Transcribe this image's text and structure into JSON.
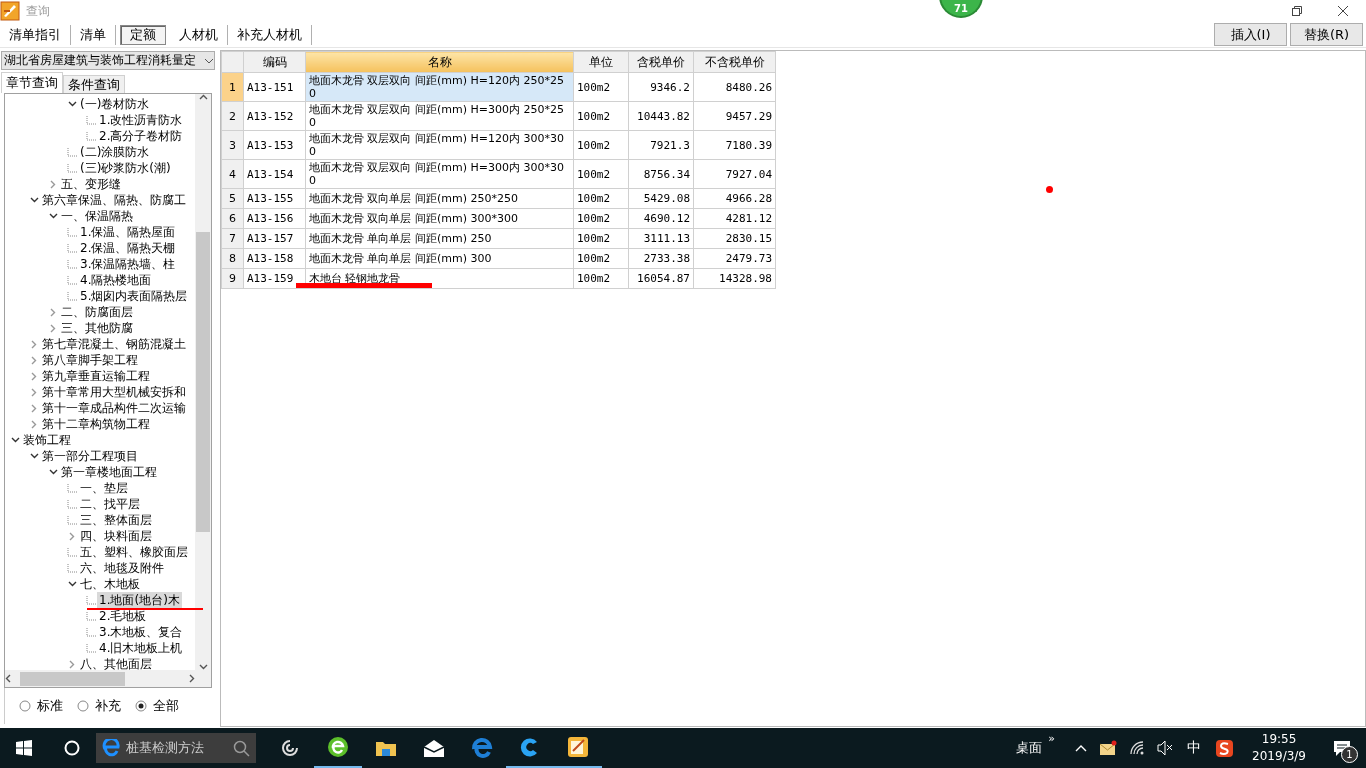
{
  "window": {
    "title": "查询",
    "badge": "71"
  },
  "tabs": [
    {
      "label": "清单指引",
      "selected": false
    },
    {
      "label": "清单",
      "selected": false
    },
    {
      "label": "定额",
      "selected": true
    },
    {
      "label": "人材机",
      "selected": false
    },
    {
      "label": "补充人材机",
      "selected": false
    }
  ],
  "buttons": [
    "插入(I)",
    "替换(R)"
  ],
  "library": {
    "value": "湖北省房屋建筑与装饰工程消耗量定"
  },
  "search_tabs": [
    {
      "label": "章节查询",
      "selected": true
    },
    {
      "label": "条件查询",
      "selected": false
    }
  ],
  "tree": [
    {
      "children": [
        {
          "children": [
            {
              "children": [
                {
                  "label": "(一)卷材防水",
                  "expanded": true,
                  "selected": false,
                  "children": [
                    {
                      "label": "1.改性沥青防水",
                      "selected": false
                    },
                    {
                      "label": "2.高分子卷材防",
                      "selected": false
                    }
                  ]
                },
                {
                  "label": "(二)涂膜防水",
                  "selected": false
                },
                {
                  "label": "(三)砂浆防水(潮)",
                  "selected": false
                }
              ]
            },
            {
              "label": "五、变形缝",
              "expanded": false,
              "selected": false
            }
          ]
        },
        {
          "label": "第六章保温、隔热、防腐工",
          "expanded": true,
          "selected": false,
          "children": [
            {
              "label": "一、保温隔热",
              "expanded": true,
              "selected": false,
              "children": [
                {
                  "label": "1.保温、隔热屋面",
                  "selected": false
                },
                {
                  "label": "2.保温、隔热天棚",
                  "selected": false
                },
                {
                  "label": "3.保温隔热墙、柱",
                  "selected": false
                },
                {
                  "label": "4.隔热楼地面",
                  "selected": false
                },
                {
                  "label": "5.烟囱内表面隔热层",
                  "selected": false
                }
              ]
            },
            {
              "label": "二、防腐面层",
              "expanded": false,
              "selected": false
            },
            {
              "label": "三、其他防腐",
              "expanded": false,
              "selected": false
            }
          ]
        },
        {
          "label": "第七章混凝土、钢筋混凝土",
          "expanded": false,
          "selected": false
        },
        {
          "label": "第八章脚手架工程",
          "expanded": false,
          "selected": false
        },
        {
          "label": "第九章垂直运输工程",
          "expanded": false,
          "selected": false
        },
        {
          "label": "第十章常用大型机械安拆和",
          "expanded": false,
          "selected": false
        },
        {
          "label": "第十一章成品构件二次运输",
          "expanded": false,
          "selected": false
        },
        {
          "label": "第十二章构筑物工程",
          "expanded": false,
          "selected": false
        }
      ]
    },
    {
      "label": "装饰工程",
      "expanded": true,
      "selected": false,
      "children": [
        {
          "label": "第一部分工程项目",
          "expanded": true,
          "selected": false,
          "children": [
            {
              "label": "第一章楼地面工程",
              "expanded": true,
              "selected": false,
              "children": [
                {
                  "label": "一、垫层",
                  "selected": false
                },
                {
                  "label": "二、找平层",
                  "selected": false
                },
                {
                  "label": "三、整体面层",
                  "selected": false
                },
                {
                  "label": "四、块料面层",
                  "expanded": false,
                  "selected": false
                },
                {
                  "label": "五、塑料、橡胶面层",
                  "selected": false
                },
                {
                  "label": "六、地毯及附件",
                  "selected": false
                },
                {
                  "label": "七、木地板",
                  "expanded": true,
                  "selected": false,
                  "children": [
                    {
                      "label": "1.地面(地台)木",
                      "selected": true
                    },
                    {
                      "label": "2.毛地板",
                      "selected": false
                    },
                    {
                      "label": "3.木地板、复合",
                      "selected": false
                    },
                    {
                      "label": "4.旧木地板上机",
                      "selected": false
                    }
                  ]
                },
                {
                  "label": "八、其他面层",
                  "expanded": false,
                  "selected": false
                }
              ]
            }
          ]
        }
      ]
    }
  ],
  "filters": [
    {
      "label": "标准",
      "selected": false
    },
    {
      "label": "补充",
      "selected": false
    },
    {
      "label": "全部",
      "selected": true
    }
  ],
  "table": {
    "columns": [
      "编码",
      "名称",
      "单位",
      "含税单价",
      "不含税单价"
    ],
    "rows": [
      {
        "index": "1",
        "code": "A13-151",
        "name": "地面木龙骨 双层双向 间距(mm) H=120内 250*250",
        "unit": "100m2",
        "price_tax": "9346.2",
        "price_notax": "8480.26",
        "selected": true
      },
      {
        "index": "2",
        "code": "A13-152",
        "name": "地面木龙骨 双层双向 间距(mm) H=300内 250*250",
        "unit": "100m2",
        "price_tax": "10443.82",
        "price_notax": "9457.29",
        "selected": false
      },
      {
        "index": "3",
        "code": "A13-153",
        "name": "地面木龙骨 双层双向 间距(mm) H=120内 300*300",
        "unit": "100m2",
        "price_tax": "7921.3",
        "price_notax": "7180.39",
        "selected": false
      },
      {
        "index": "4",
        "code": "A13-154",
        "name": "地面木龙骨 双层双向 间距(mm) H=300内 300*300",
        "unit": "100m2",
        "price_tax": "8756.34",
        "price_notax": "7927.04",
        "selected": false
      },
      {
        "index": "5",
        "code": "A13-155",
        "name": "地面木龙骨 双向单层 间距(mm) 250*250",
        "unit": "100m2",
        "price_tax": "5429.08",
        "price_notax": "4966.28",
        "selected": false
      },
      {
        "index": "6",
        "code": "A13-156",
        "name": "地面木龙骨 双向单层 间距(mm) 300*300",
        "unit": "100m2",
        "price_tax": "4690.12",
        "price_notax": "4281.12",
        "selected": false
      },
      {
        "index": "7",
        "code": "A13-157",
        "name": "地面木龙骨 单向单层 间距(mm) 250",
        "unit": "100m2",
        "price_tax": "3111.13",
        "price_notax": "2830.15",
        "selected": false
      },
      {
        "index": "8",
        "code": "A13-158",
        "name": "地面木龙骨 单向单层 间距(mm) 300",
        "unit": "100m2",
        "price_tax": "2733.38",
        "price_notax": "2479.73",
        "selected": false
      },
      {
        "index": "9",
        "code": "A13-159",
        "name": "木地台 轻钢地龙骨",
        "unit": "100m2",
        "price_tax": "16054.87",
        "price_notax": "14328.98",
        "selected": false
      }
    ]
  },
  "taskbar": {
    "search": {
      "value": "桩基检测方法"
    },
    "desktop_label": "桌面",
    "overflow": "»",
    "ime": "中",
    "time": "19:55",
    "date": "2019/3/9",
    "notifications": "1"
  }
}
